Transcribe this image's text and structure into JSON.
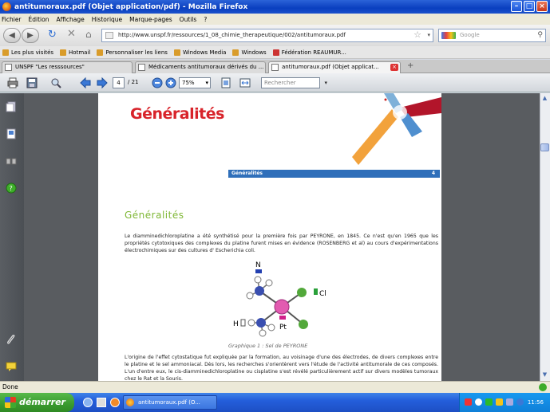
{
  "window": {
    "title": "antitumoraux.pdf (Objet application/pdf) - Mozilla Firefox"
  },
  "menu": [
    "Fichier",
    "Édition",
    "Affichage",
    "Historique",
    "Marque-pages",
    "Outils",
    "?"
  ],
  "address": {
    "url": "http://www.unspf.fr/ressources/1_08_chimie_therapeutique/002/antitumoraux.pdf",
    "search_placeholder": "Google"
  },
  "bookmarks": [
    "Les plus visités",
    "Hotmail",
    "Personnaliser les liens",
    "Windows Media",
    "Windows",
    "Fédération REAUMUR..."
  ],
  "tabs": [
    {
      "label": "UNSPF \"Les resssources\"",
      "active": false
    },
    {
      "label": "Médicaments antitumoraux dérivés du ...",
      "active": false
    },
    {
      "label": "antitumoraux.pdf (Objet applicat...",
      "active": true
    }
  ],
  "pdf_toolbar": {
    "page_current": "4",
    "page_total": "/ 21",
    "zoom": "75%",
    "search_placeholder": "Rechercher"
  },
  "document": {
    "header_title": "Généralités",
    "section_label": "Généralités",
    "section_number": "4",
    "heading": "Généralités",
    "para1": "Le diamminedichloroplatine a été synthétisé pour la première fois par PEYRONE, en 1845. Ce n'est qu'en 1965 que les propriétés cytotoxiques des complexes du platine furent mises en évidence (ROSENBERG et al) au cours d'expérimentations électrochimiques sur des cultures d' Escherichia coli.",
    "molecule_labels": {
      "n": "N",
      "cl": "Cl",
      "h": "H",
      "pt": "Pt"
    },
    "caption": "Graphique 1  :  Sel de PEYRONE",
    "para2": "L'origine de l'effet cytostatique fut expliquée par la formation, au voisinage d'une des électrodes, de divers complexes entre le platine et le sel ammoniacal. Dès lors, les recherches s'orientèrent vers l'étude de l'activité antitumorale de ces composés. L'un d'entre eux, le cis-diamminedichloroplatine ou cisplatine s'est révélé particulièrement actif sur divers modèles tumoraux chez le Rat et la Souris."
  },
  "status": {
    "text": "Done"
  },
  "taskbar": {
    "start": "démarrer",
    "item": "antitumoraux.pdf (O...",
    "clock": "11:56"
  }
}
